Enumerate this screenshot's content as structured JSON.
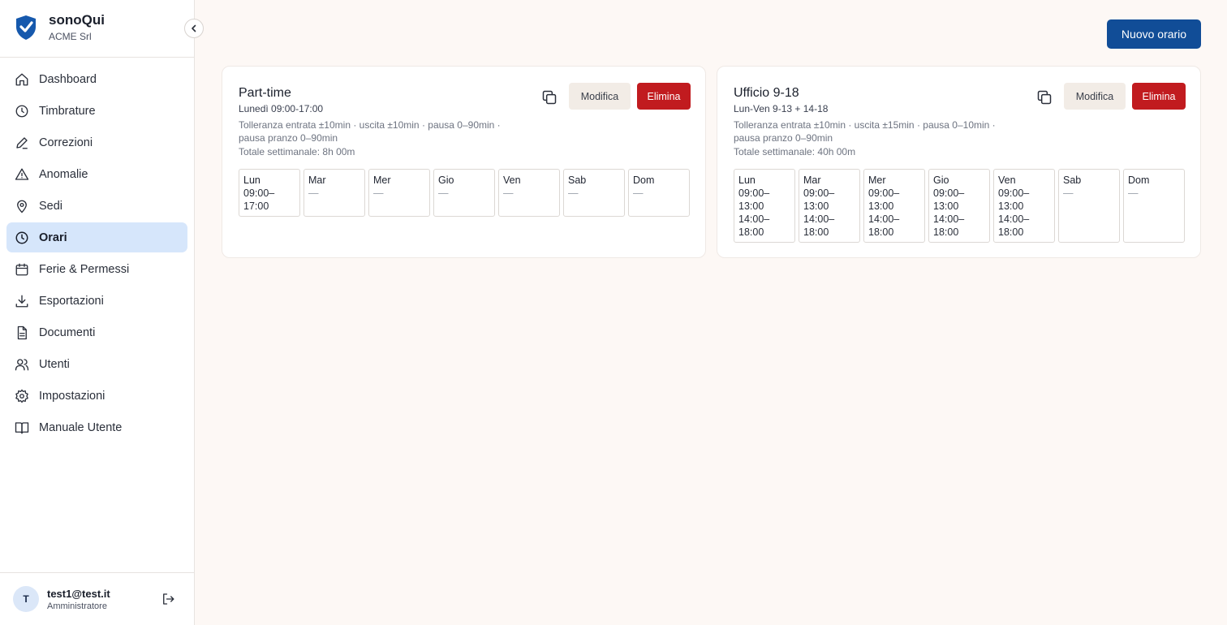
{
  "brand": {
    "name": "sonoQui",
    "org": "ACME Srl"
  },
  "nav": [
    {
      "label": "Dashboard",
      "icon": "home-icon",
      "active": false
    },
    {
      "label": "Timbrature",
      "icon": "clock-icon",
      "active": false
    },
    {
      "label": "Correzioni",
      "icon": "pencil-icon",
      "active": false
    },
    {
      "label": "Anomalie",
      "icon": "warning-icon",
      "active": false
    },
    {
      "label": "Sedi",
      "icon": "map-pin-icon",
      "active": false
    },
    {
      "label": "Orari",
      "icon": "clock-icon",
      "active": true
    },
    {
      "label": "Ferie & Permessi",
      "icon": "calendar-icon",
      "active": false
    },
    {
      "label": "Esportazioni",
      "icon": "download-icon",
      "active": false
    },
    {
      "label": "Documenti",
      "icon": "document-icon",
      "active": false
    },
    {
      "label": "Utenti",
      "icon": "users-icon",
      "active": false
    },
    {
      "label": "Impostazioni",
      "icon": "gear-icon",
      "active": false
    },
    {
      "label": "Manuale Utente",
      "icon": "book-icon",
      "active": false
    }
  ],
  "user": {
    "initial": "T",
    "email": "test1@test.it",
    "role": "Amministratore"
  },
  "header": {
    "new_button": "Nuovo orario"
  },
  "colors": {
    "primary": "#114d97",
    "danger": "#c11b1f",
    "active_nav": "#d6e6fb"
  },
  "schedules": [
    {
      "title": "Part-time",
      "subtitle": "Lunedì 09:00-17:00",
      "tolerance": "Tolleranza entrata ±10min · uscita ±10min · pausa 0–90min · pausa pranzo 0–90min",
      "total": "Totale settimanale: 8h 00m",
      "edit_label": "Modifica",
      "delete_label": "Elimina",
      "days": [
        {
          "name": "Lun",
          "value": "09:00–\n17:00"
        },
        {
          "name": "Mar",
          "value": "—"
        },
        {
          "name": "Mer",
          "value": "—"
        },
        {
          "name": "Gio",
          "value": "—"
        },
        {
          "name": "Ven",
          "value": "—"
        },
        {
          "name": "Sab",
          "value": "—"
        },
        {
          "name": "Dom",
          "value": "—"
        }
      ]
    },
    {
      "title": "Ufficio 9-18",
      "subtitle": "Lun-Ven 9-13 + 14-18",
      "tolerance": "Tolleranza entrata ±10min · uscita ±15min · pausa 0–10min · pausa pranzo 0–90min",
      "total": "Totale settimanale: 40h 00m",
      "edit_label": "Modifica",
      "delete_label": "Elimina",
      "days": [
        {
          "name": "Lun",
          "value": "09:00–\n13:00\n14:00–\n18:00"
        },
        {
          "name": "Mar",
          "value": "09:00–\n13:00\n14:00–\n18:00"
        },
        {
          "name": "Mer",
          "value": "09:00–\n13:00\n14:00–\n18:00"
        },
        {
          "name": "Gio",
          "value": "09:00–\n13:00\n14:00–\n18:00"
        },
        {
          "name": "Ven",
          "value": "09:00–\n13:00\n14:00–\n18:00"
        },
        {
          "name": "Sab",
          "value": "—"
        },
        {
          "name": "Dom",
          "value": "—"
        }
      ]
    }
  ]
}
